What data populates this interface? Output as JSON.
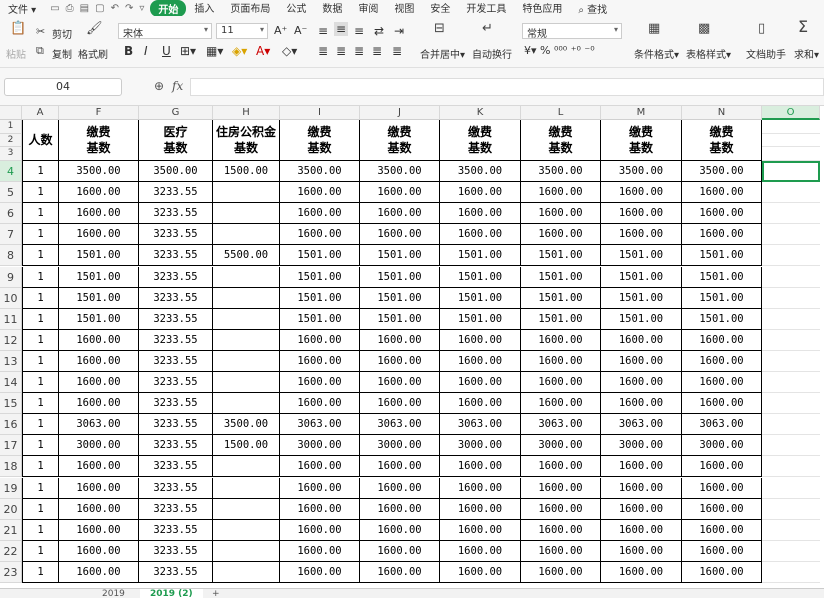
{
  "menu": {
    "file": "文件",
    "tabs": [
      "开始",
      "插入",
      "页面布局",
      "公式",
      "数据",
      "审阅",
      "视图",
      "安全",
      "开发工具",
      "特色应用"
    ],
    "search": "查找"
  },
  "ribbon": {
    "paste": "粘贴",
    "cut": "剪切",
    "copy": "复制",
    "format_painter": "格式刷",
    "font_name": "宋体",
    "font_size": "11",
    "merge_center": "合并居中",
    "wrap_text": "自动换行",
    "number_format": "常规",
    "conditional_format": "条件格式",
    "table_style": "表格样式",
    "doc_assistant": "文档助手",
    "sum": "求和"
  },
  "formula_bar": {
    "name_box": "04",
    "fx": "fx",
    "formula": ""
  },
  "columns": [
    "A",
    "F",
    "G",
    "H",
    "I",
    "J",
    "K",
    "L",
    "M",
    "N",
    "O"
  ],
  "header_rows": [
    "1",
    "2",
    "3"
  ],
  "table_header": [
    "人数",
    "缴费\n基数",
    "医疗\n基数",
    "住房公积金\n基数",
    "缴费\n基数",
    "缴费\n基数",
    "缴费\n基数",
    "缴费\n基数",
    "缴费\n基数",
    "缴费\n基数"
  ],
  "rows": [
    {
      "n": "4",
      "v": [
        "1",
        "3500.00",
        "3500.00",
        "1500.00",
        "3500.00",
        "3500.00",
        "3500.00",
        "3500.00",
        "3500.00",
        "3500.00"
      ]
    },
    {
      "n": "5",
      "v": [
        "1",
        "1600.00",
        "3233.55",
        "",
        "1600.00",
        "1600.00",
        "1600.00",
        "1600.00",
        "1600.00",
        "1600.00"
      ]
    },
    {
      "n": "6",
      "v": [
        "1",
        "1600.00",
        "3233.55",
        "",
        "1600.00",
        "1600.00",
        "1600.00",
        "1600.00",
        "1600.00",
        "1600.00"
      ]
    },
    {
      "n": "7",
      "v": [
        "1",
        "1600.00",
        "3233.55",
        "",
        "1600.00",
        "1600.00",
        "1600.00",
        "1600.00",
        "1600.00",
        "1600.00"
      ]
    },
    {
      "n": "8",
      "v": [
        "1",
        "1501.00",
        "3233.55",
        "5500.00",
        "1501.00",
        "1501.00",
        "1501.00",
        "1501.00",
        "1501.00",
        "1501.00"
      ]
    },
    {
      "n": "9",
      "v": [
        "1",
        "1501.00",
        "3233.55",
        "",
        "1501.00",
        "1501.00",
        "1501.00",
        "1501.00",
        "1501.00",
        "1501.00"
      ]
    },
    {
      "n": "10",
      "v": [
        "1",
        "1501.00",
        "3233.55",
        "",
        "1501.00",
        "1501.00",
        "1501.00",
        "1501.00",
        "1501.00",
        "1501.00"
      ]
    },
    {
      "n": "11",
      "v": [
        "1",
        "1501.00",
        "3233.55",
        "",
        "1501.00",
        "1501.00",
        "1501.00",
        "1501.00",
        "1501.00",
        "1501.00"
      ]
    },
    {
      "n": "12",
      "v": [
        "1",
        "1600.00",
        "3233.55",
        "",
        "1600.00",
        "1600.00",
        "1600.00",
        "1600.00",
        "1600.00",
        "1600.00"
      ]
    },
    {
      "n": "13",
      "v": [
        "1",
        "1600.00",
        "3233.55",
        "",
        "1600.00",
        "1600.00",
        "1600.00",
        "1600.00",
        "1600.00",
        "1600.00"
      ]
    },
    {
      "n": "14",
      "v": [
        "1",
        "1600.00",
        "3233.55",
        "",
        "1600.00",
        "1600.00",
        "1600.00",
        "1600.00",
        "1600.00",
        "1600.00"
      ]
    },
    {
      "n": "15",
      "v": [
        "1",
        "1600.00",
        "3233.55",
        "",
        "1600.00",
        "1600.00",
        "1600.00",
        "1600.00",
        "1600.00",
        "1600.00"
      ]
    },
    {
      "n": "16",
      "v": [
        "1",
        "3063.00",
        "3233.55",
        "3500.00",
        "3063.00",
        "3063.00",
        "3063.00",
        "3063.00",
        "3063.00",
        "3063.00"
      ]
    },
    {
      "n": "17",
      "v": [
        "1",
        "3000.00",
        "3233.55",
        "1500.00",
        "3000.00",
        "3000.00",
        "3000.00",
        "3000.00",
        "3000.00",
        "3000.00"
      ]
    },
    {
      "n": "18",
      "v": [
        "1",
        "1600.00",
        "3233.55",
        "",
        "1600.00",
        "1600.00",
        "1600.00",
        "1600.00",
        "1600.00",
        "1600.00"
      ]
    },
    {
      "n": "19",
      "v": [
        "1",
        "1600.00",
        "3233.55",
        "",
        "1600.00",
        "1600.00",
        "1600.00",
        "1600.00",
        "1600.00",
        "1600.00"
      ]
    },
    {
      "n": "20",
      "v": [
        "1",
        "1600.00",
        "3233.55",
        "",
        "1600.00",
        "1600.00",
        "1600.00",
        "1600.00",
        "1600.00",
        "1600.00"
      ]
    },
    {
      "n": "21",
      "v": [
        "1",
        "1600.00",
        "3233.55",
        "",
        "1600.00",
        "1600.00",
        "1600.00",
        "1600.00",
        "1600.00",
        "1600.00"
      ]
    },
    {
      "n": "22",
      "v": [
        "1",
        "1600.00",
        "3233.55",
        "",
        "1600.00",
        "1600.00",
        "1600.00",
        "1600.00",
        "1600.00",
        "1600.00"
      ]
    },
    {
      "n": "23",
      "v": [
        "1",
        "1600.00",
        "3233.55",
        "",
        "1600.00",
        "1600.00",
        "1600.00",
        "1600.00",
        "1600.00",
        "1600.00"
      ]
    }
  ],
  "sheets": [
    "2019",
    "2019 (2)"
  ],
  "accent_color": "#1e9b4f"
}
